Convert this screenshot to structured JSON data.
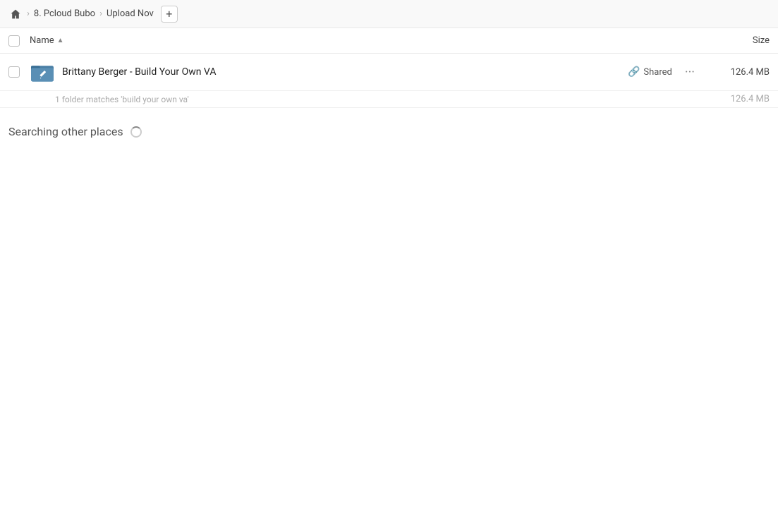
{
  "breadcrumb": {
    "home_label": "Home",
    "item1_label": "8. Pcloud Bubo",
    "item2_label": "Upload Nov",
    "add_label": "+"
  },
  "columns": {
    "name_label": "Name",
    "sort_indicator": "▲",
    "size_label": "Size"
  },
  "file_row": {
    "name": "Brittany Berger - Build Your Own VA",
    "shared_label": "Shared",
    "size": "126.4 MB",
    "more_label": "···"
  },
  "match_row": {
    "text": "1 folder matches 'build your own va'",
    "size": "126.4 MB"
  },
  "searching": {
    "label": "Searching other places"
  }
}
